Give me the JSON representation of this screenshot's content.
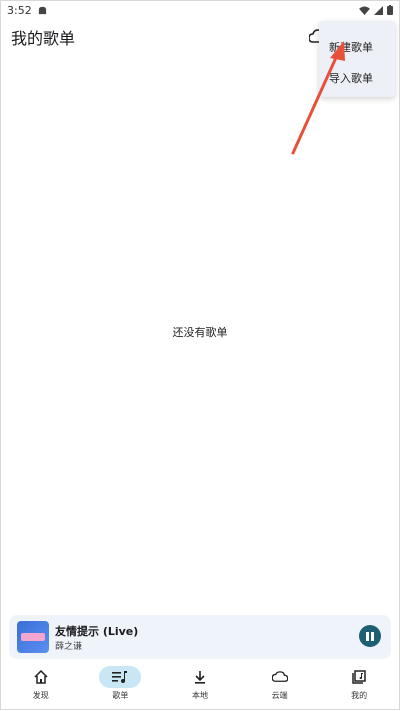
{
  "status_bar": {
    "time": "3:52"
  },
  "header": {
    "title": "我的歌单"
  },
  "menu": {
    "items": [
      {
        "label": "新建歌单"
      },
      {
        "label": "导入歌单"
      }
    ]
  },
  "empty_state": {
    "text": "还没有歌单"
  },
  "player": {
    "song_title": "友情提示 (Live)",
    "artist": "薛之谦"
  },
  "nav": {
    "items": [
      {
        "label": "发现",
        "icon": "home-icon"
      },
      {
        "label": "歌单",
        "icon": "playlist-icon"
      },
      {
        "label": "本地",
        "icon": "download-icon"
      },
      {
        "label": "云端",
        "icon": "cloud-icon"
      },
      {
        "label": "我的",
        "icon": "library-icon"
      }
    ],
    "active_index": 1
  },
  "colors": {
    "accent": "#1f5f73",
    "nav_active_bg": "#c9e6f5",
    "arrow": "#e8503a",
    "menu_bg": "#eef0f8"
  }
}
